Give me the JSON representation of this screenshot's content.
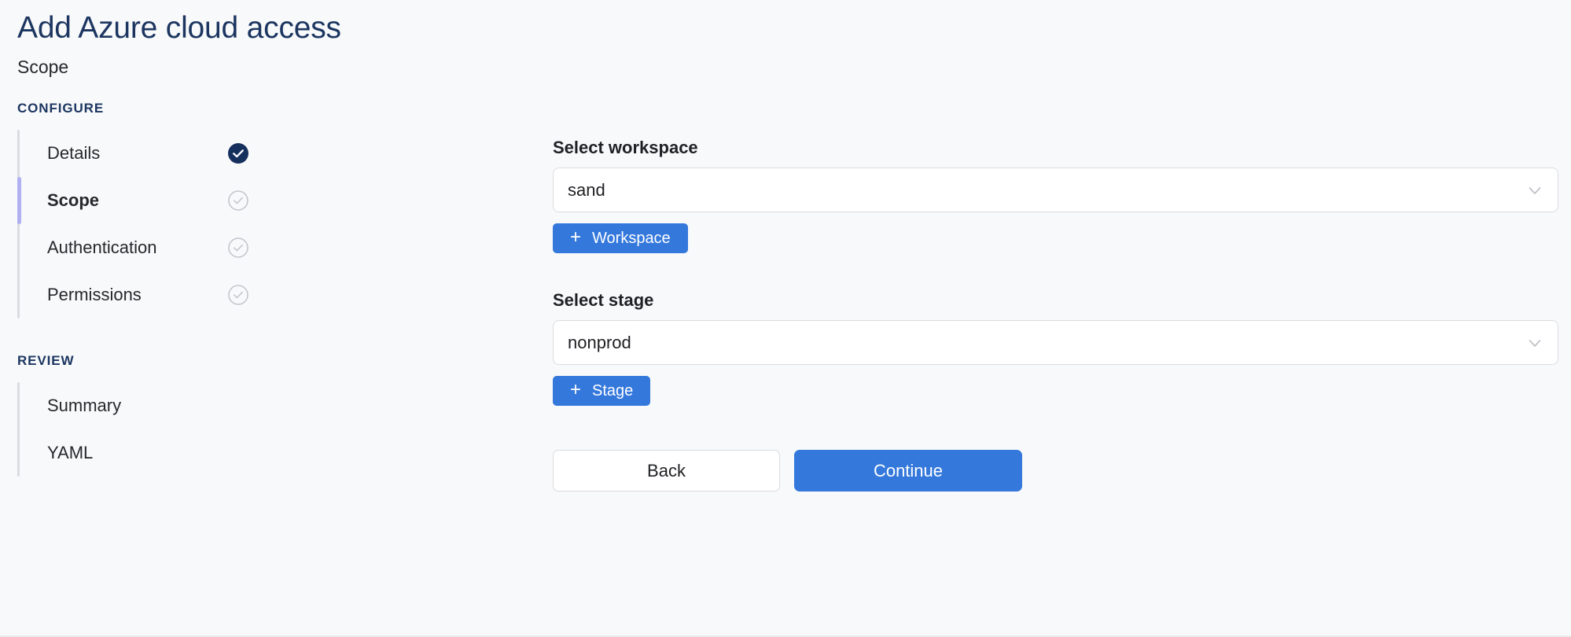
{
  "header": {
    "title": "Add Azure cloud access",
    "subtitle": "Scope"
  },
  "stepper": {
    "groups": [
      {
        "title": "CONFIGURE",
        "steps": [
          {
            "label": "Details",
            "state": "complete",
            "active": false,
            "icon": "check-circle-filled-icon"
          },
          {
            "label": "Scope",
            "state": "current",
            "active": true,
            "icon": "check-circle-outline-icon"
          },
          {
            "label": "Authentication",
            "state": "pending",
            "active": false,
            "icon": "check-circle-outline-icon"
          },
          {
            "label": "Permissions",
            "state": "pending",
            "active": false,
            "icon": "check-circle-outline-icon"
          }
        ]
      },
      {
        "title": "REVIEW",
        "steps": [
          {
            "label": "Summary",
            "state": "pending",
            "active": false,
            "icon": "none"
          },
          {
            "label": "YAML",
            "state": "pending",
            "active": false,
            "icon": "none"
          }
        ]
      }
    ]
  },
  "form": {
    "workspace": {
      "label": "Select workspace",
      "value": "sand",
      "placeholder": "Select workspace",
      "chevron_icon": "chevron-down-icon",
      "add_button": {
        "label": "Workspace",
        "plus": "+"
      }
    },
    "stage": {
      "label": "Select stage",
      "value": "nonprod",
      "placeholder": "Select stage",
      "chevron_icon": "chevron-down-icon",
      "add_button": {
        "label": "Stage",
        "plus": "+"
      }
    }
  },
  "actions": {
    "back_label": "Back",
    "continue_label": "Continue"
  },
  "colors": {
    "page_background": "#f8f9fa",
    "title_navy": "#1c3661",
    "accent_blue": "#3478dc",
    "active_step_purple": "#b0b0f2",
    "rail_gray": "#dadce0",
    "complete_navy": "#16305e",
    "pending_gray": "#c3c7cd"
  }
}
